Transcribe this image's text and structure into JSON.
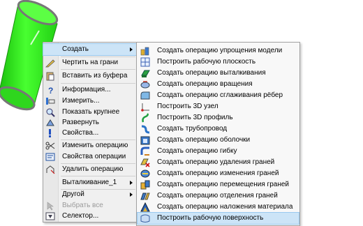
{
  "context_menu": {
    "items": [
      {
        "label": "Создать",
        "icon": "create-icon",
        "submenu": true
      },
      {
        "label": "Чертить на грани",
        "icon": "pencil-icon"
      },
      {
        "label": "Вставить из буфера",
        "icon": "paste-icon"
      },
      {
        "label": "Информация...",
        "icon": "help-icon"
      },
      {
        "label": "Измерить...",
        "icon": "measure-icon"
      },
      {
        "label": "Показать крупнее",
        "icon": "zoom-in-icon"
      },
      {
        "label": "Развернуть",
        "icon": "unfold-icon"
      },
      {
        "label": "Свойства...",
        "icon": "properties-icon"
      },
      {
        "label": "Изменить операцию",
        "icon": "scissors-icon"
      },
      {
        "label": "Свойства операции",
        "icon": "operation-properties-icon"
      },
      {
        "label": "Удалить операцию",
        "icon": "delete-operation-icon"
      },
      {
        "label": "Выталкивание_1",
        "submenu": true
      },
      {
        "label": "Другой",
        "submenu": true
      },
      {
        "label": "Выбрать все",
        "disabled": true,
        "icon": "select-all-icon"
      },
      {
        "label": "Селектор...",
        "icon": "selector-icon"
      }
    ]
  },
  "submenu": {
    "items": [
      {
        "label": "Создать операцию упрощения модели",
        "icon": "simplify-icon"
      },
      {
        "label": "Построить рабочую плоскость",
        "icon": "workplane-icon"
      },
      {
        "label": "Создать операцию выталкивания",
        "icon": "extrude-icon"
      },
      {
        "label": "Создать операцию вращения",
        "icon": "rotate-icon"
      },
      {
        "label": "Создать операцию сглаживания рёбер",
        "icon": "fillet-icon"
      },
      {
        "label": "Построить 3D узел",
        "icon": "node-3d-icon"
      },
      {
        "label": "Построить 3D профиль",
        "icon": "profile-3d-icon"
      },
      {
        "label": "Создать трубопровод",
        "icon": "pipe-icon"
      },
      {
        "label": "Создать операцию оболочки",
        "icon": "shell-icon"
      },
      {
        "label": "Создать операцию гибку",
        "icon": "bend-icon"
      },
      {
        "label": "Создать операцию удаления граней",
        "icon": "delete-faces-icon"
      },
      {
        "label": "Создать операцию изменения граней",
        "icon": "modify-faces-icon"
      },
      {
        "label": "Создать операцию перемещения граней",
        "icon": "move-faces-icon"
      },
      {
        "label": "Создать операцию отделения граней",
        "icon": "separate-faces-icon"
      },
      {
        "label": "Создать операцию наложения материала",
        "icon": "material-icon"
      },
      {
        "label": "Построить рабочую поверхность",
        "icon": "work-surface-icon"
      }
    ]
  },
  "colors": {
    "cylinder": "#33ee22",
    "highlight": "#cce4f7",
    "menu_bg": "#f0f0f0"
  }
}
